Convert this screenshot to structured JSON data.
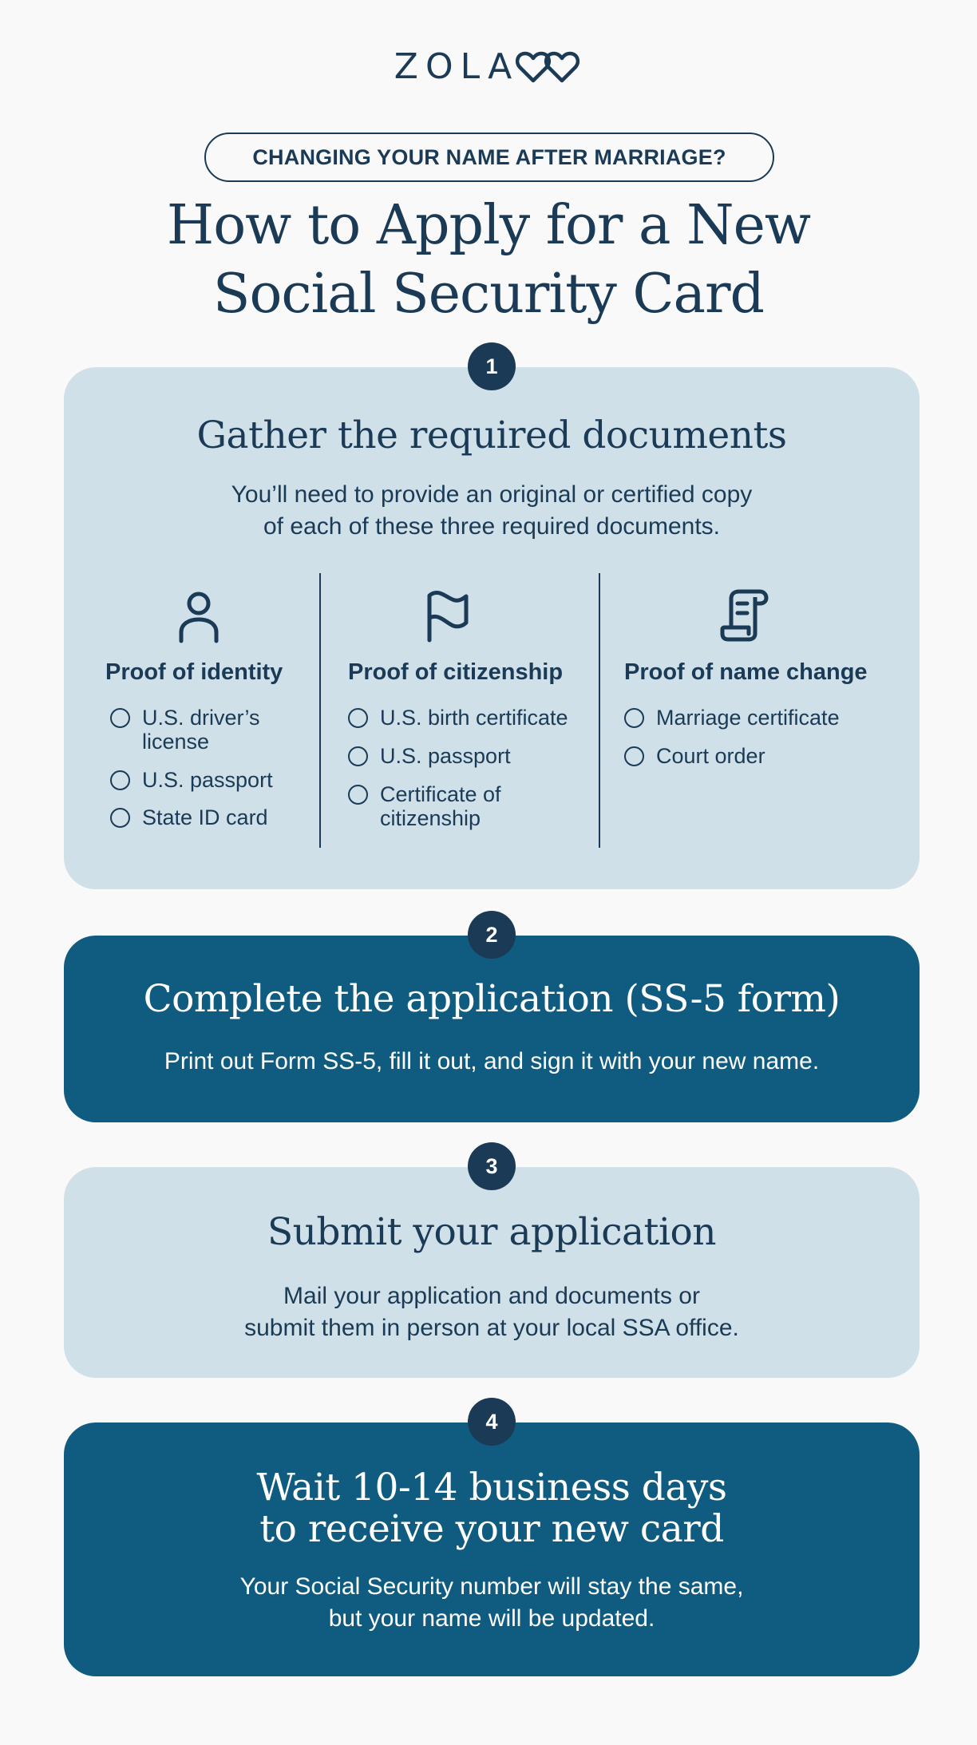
{
  "brand": {
    "name": "ZOLA",
    "logo_icon": "interlocked-hearts-icon"
  },
  "header": {
    "eyebrow": "CHANGING YOUR NAME AFTER MARRIAGE?",
    "title_line1": "How to Apply for a New",
    "title_line2": "Social Security Card"
  },
  "colors": {
    "navy": "#1a3a56",
    "light_card": "#cfe0e8",
    "dark_card": "#0f5c80",
    "background": "#f9f9f9"
  },
  "steps": [
    {
      "number": "1",
      "title": "Gather the required documents",
      "desc_line1": "You’ll need to provide an original or certified copy",
      "desc_line2": "of each of these three required documents.",
      "columns": [
        {
          "icon": "person-icon",
          "title": "Proof of identity",
          "options": [
            "U.S. driver’s\nlicense",
            "U.S. passport",
            "State ID card"
          ]
        },
        {
          "icon": "flag-icon",
          "title": "Proof of citizenship",
          "options": [
            "U.S. birth certificate",
            "U.S. passport",
            "Certificate of\ncitizenship"
          ]
        },
        {
          "icon": "scroll-document-icon",
          "title": "Proof of name change",
          "options": [
            "Marriage certificate",
            "Court order"
          ]
        }
      ]
    },
    {
      "number": "2",
      "title": "Complete the application (SS-5 form)",
      "desc_line1": "Print out Form SS-5, fill it out, and sign it with your new name."
    },
    {
      "number": "3",
      "title": "Submit your application",
      "desc_line1": "Mail your application and documents or",
      "desc_line2": "submit them in person at your local SSA office."
    },
    {
      "number": "4",
      "title_line1": "Wait 10-14 business days",
      "title_line2": "to receive your new card",
      "desc_line1": "Your Social Security number will stay the same,",
      "desc_line2": "but your name will be updated."
    }
  ]
}
